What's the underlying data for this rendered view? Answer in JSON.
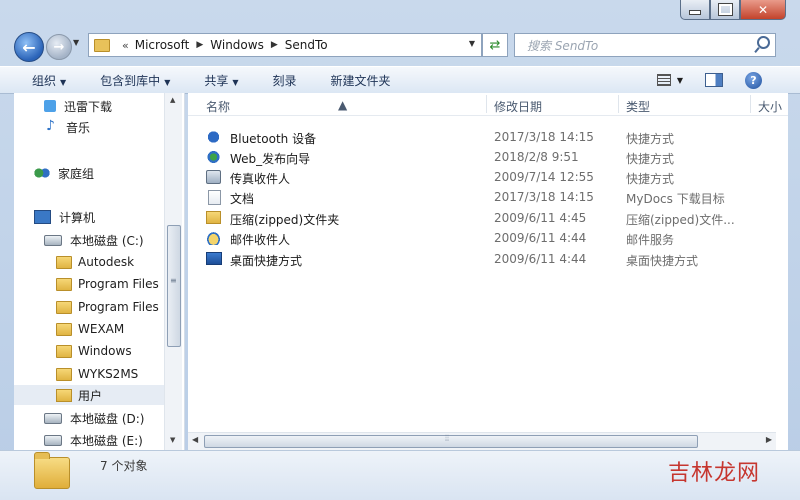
{
  "address": {
    "crumbs": [
      "Microsoft",
      "Windows",
      "SendTo"
    ],
    "search_placeholder": "搜索 SendTo"
  },
  "toolbar": {
    "organize": "组织",
    "include": "包含到库中",
    "share": "共享",
    "burn": "刻录",
    "new_folder": "新建文件夹"
  },
  "nav": {
    "items": [
      {
        "label": "迅雷下载",
        "icon": "download-icon"
      },
      {
        "label": "音乐",
        "icon": "music-icon"
      },
      {
        "label": "家庭组",
        "icon": "homegroup-icon"
      },
      {
        "label": "计算机",
        "icon": "computer-icon"
      },
      {
        "label": "本地磁盘 (C:)",
        "icon": "drive-icon"
      },
      {
        "label": "Autodesk",
        "icon": "folder-icon"
      },
      {
        "label": "Program Files",
        "icon": "folder-icon"
      },
      {
        "label": "Program Files",
        "icon": "folder-icon"
      },
      {
        "label": "WEXAM",
        "icon": "folder-icon"
      },
      {
        "label": "Windows",
        "icon": "folder-icon"
      },
      {
        "label": "WYKS2MS",
        "icon": "folder-icon"
      },
      {
        "label": "用户",
        "icon": "folder-icon"
      },
      {
        "label": "本地磁盘 (D:)",
        "icon": "drive-icon"
      },
      {
        "label": "本地磁盘 (E:)",
        "icon": "drive-icon"
      }
    ]
  },
  "columns": {
    "name": "名称",
    "date": "修改日期",
    "type": "类型",
    "size": "大小"
  },
  "files": [
    {
      "name": "Bluetooth 设备",
      "date": "2017/3/18 14:15",
      "type": "快捷方式",
      "icon": "bluetooth-icon"
    },
    {
      "name": "Web_发布向导",
      "date": "2018/2/8 9:51",
      "type": "快捷方式",
      "icon": "web-publish-icon"
    },
    {
      "name": "传真收件人",
      "date": "2009/7/14 12:55",
      "type": "快捷方式",
      "icon": "fax-icon"
    },
    {
      "name": "文档",
      "date": "2017/3/18 14:15",
      "type": "MyDocs 下载目标",
      "icon": "document-icon"
    },
    {
      "name": "压缩(zipped)文件夹",
      "date": "2009/6/11 4:45",
      "type": "压缩(zipped)文件...",
      "icon": "zip-folder-icon"
    },
    {
      "name": "邮件收件人",
      "date": "2009/6/11 4:44",
      "type": "邮件服务",
      "icon": "mail-icon"
    },
    {
      "name": "桌面快捷方式",
      "date": "2009/6/11 4:44",
      "type": "桌面快捷方式",
      "icon": "desktop-icon"
    }
  ],
  "status": {
    "count": "7 个对象"
  },
  "watermark": "吉林龙网"
}
